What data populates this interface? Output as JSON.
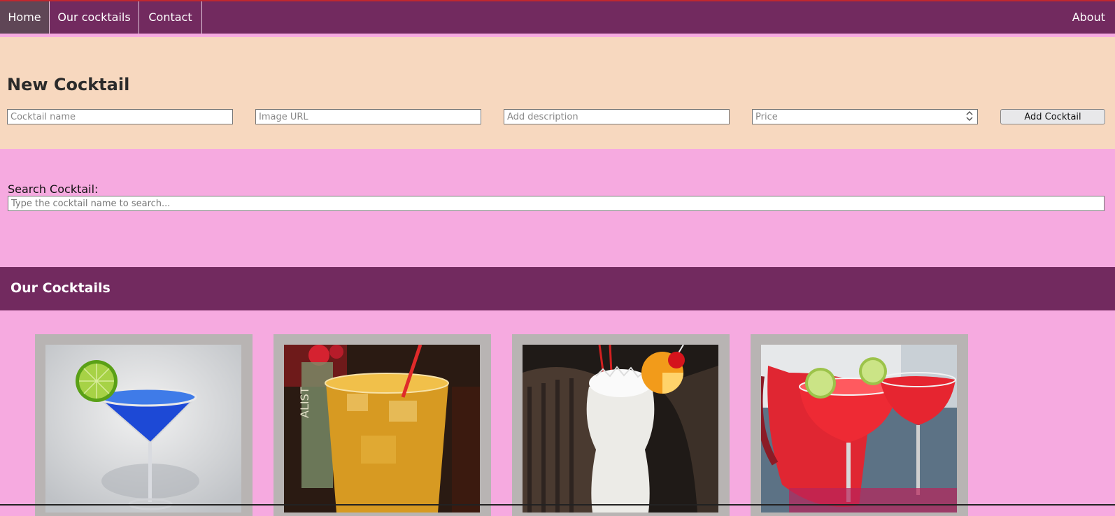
{
  "nav": {
    "home": "Home",
    "cocktails": "Our cocktails",
    "contact": "Contact",
    "about": "About"
  },
  "new_cocktail": {
    "title": "New Cocktail",
    "name_placeholder": "Cocktail name",
    "url_placeholder": "Image URL",
    "description_placeholder": "Add description",
    "price_placeholder": "Price",
    "add_button": "Add Cocktail"
  },
  "search": {
    "label": "Search Cocktail:",
    "placeholder": "Type the cocktail name to search..."
  },
  "our_cocktails": {
    "title": "Our Cocktails"
  },
  "colors": {
    "nav_bg": "#722a5f",
    "page_bg": "#f6aae0",
    "form_bg": "#f7d8bf",
    "card_bg": "#b8b4b3"
  }
}
